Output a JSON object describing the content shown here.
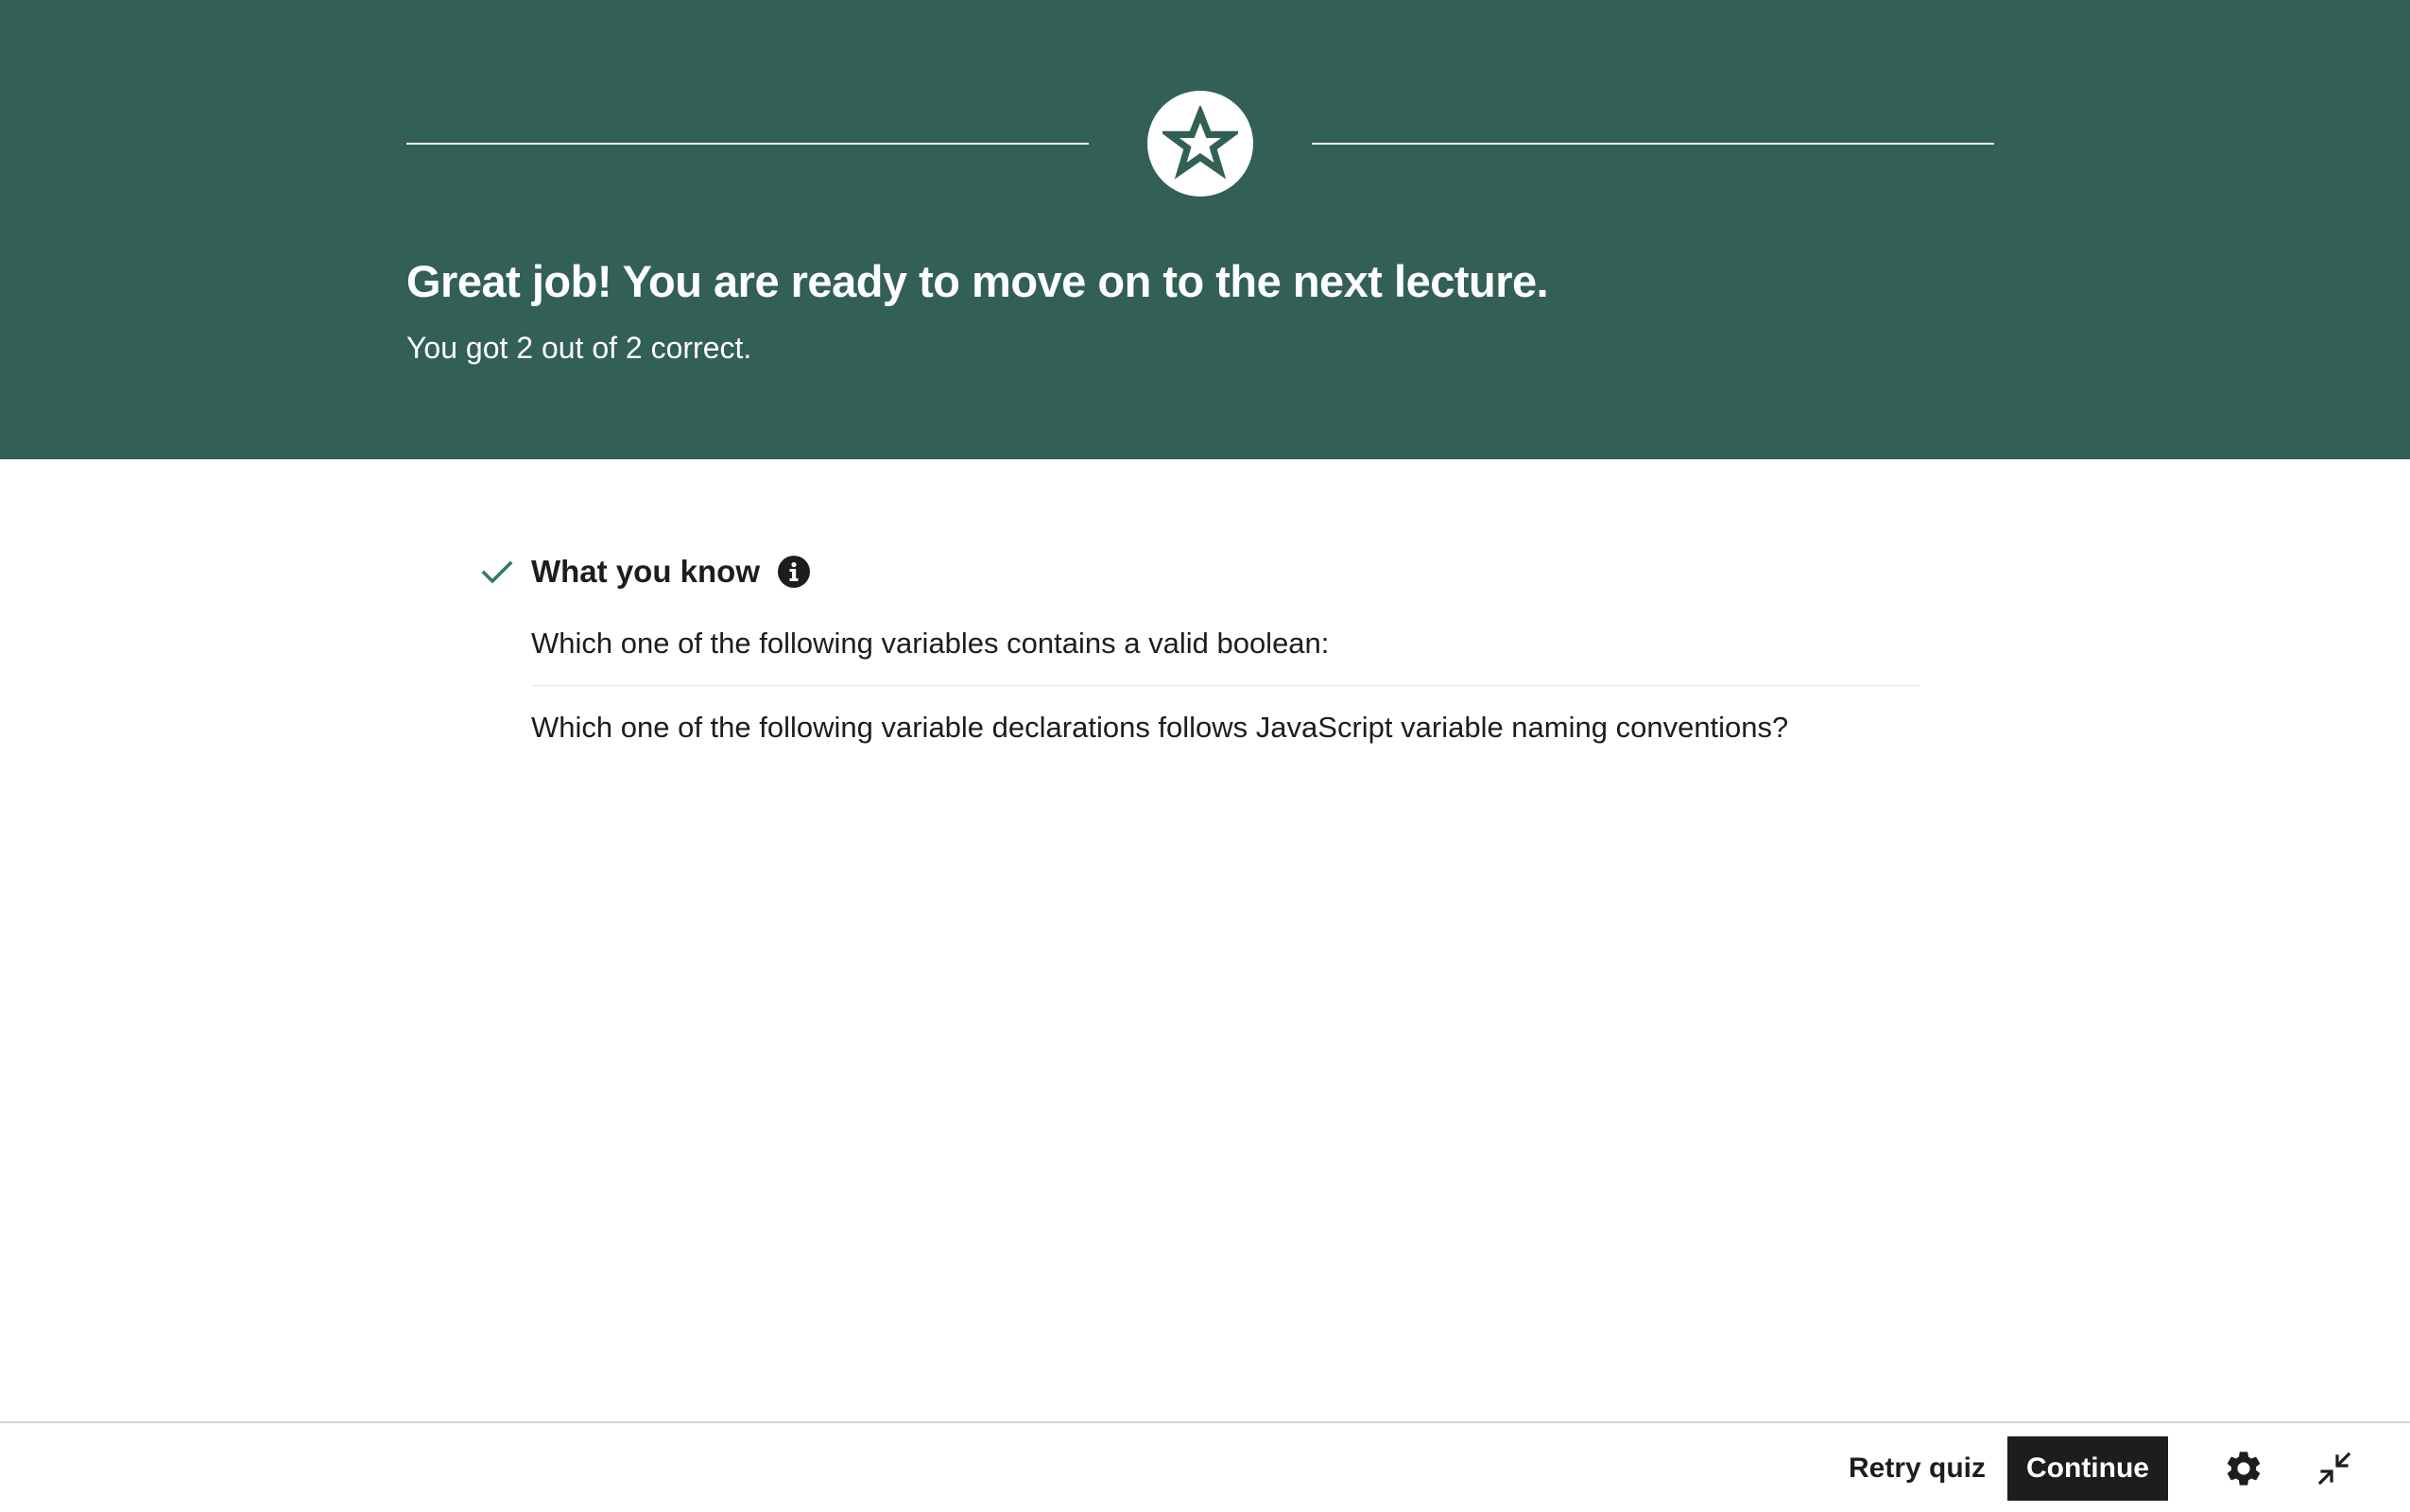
{
  "banner": {
    "title": "Great job! You are ready to move on to the next lecture.",
    "subtitle": "You got 2 out of 2 correct.",
    "badge_icon": "star-icon",
    "background_color": "#325f56"
  },
  "results": {
    "section_title": "What you know",
    "section_icon": "check-icon",
    "info_icon": "info-icon",
    "accent_color": "#2d7a62",
    "questions": [
      "Which one of the following variables contains a valid boolean:",
      "Which one of the following variable declarations follows JavaScript variable naming conventions?"
    ]
  },
  "footer": {
    "retry_label": "Retry quiz",
    "continue_label": "Continue",
    "settings_icon": "gear-icon",
    "collapse_icon": "collapse-icon"
  }
}
